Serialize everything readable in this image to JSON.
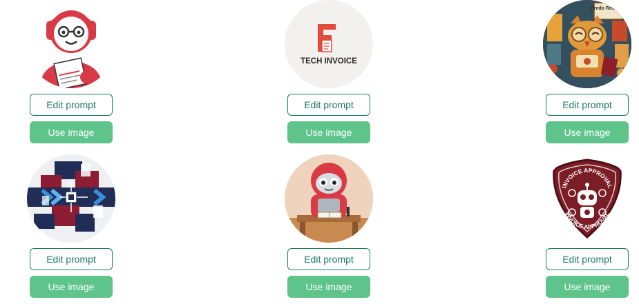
{
  "gallery": {
    "items": [
      {
        "image": "report-robot-avatar",
        "edit_label": "Edit prompt",
        "use_label": "Use image"
      },
      {
        "image": "tech-invoice-logo",
        "logo_text": "TECH INVOICE",
        "edit_label": "Edit prompt",
        "use_label": "Use image"
      },
      {
        "image": "retro-owl-robot-avatar",
        "sign_text": "Fredo Retro-Da",
        "edit_label": "Edit prompt",
        "use_label": "Use image"
      },
      {
        "image": "arrows-circuit-graphic",
        "edit_label": "Edit prompt",
        "use_label": "Use image"
      },
      {
        "image": "desk-robot-avatar",
        "edit_label": "Edit prompt",
        "use_label": "Use image"
      },
      {
        "image": "invoice-approval-badge",
        "badge_text": "INVOICE APPROVAL",
        "edit_label": "Edit prompt",
        "use_label": "Use image"
      }
    ]
  },
  "colors": {
    "edit_border": "#1f7a62",
    "use_background": "#5ec48c",
    "robot_red": "#d93a45",
    "badge_maroon": "#7b1d26"
  }
}
